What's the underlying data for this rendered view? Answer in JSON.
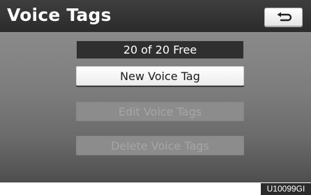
{
  "header": {
    "title": "Voice Tags",
    "back_icon": "return-arrow-icon"
  },
  "status": {
    "free_count_text": "20 of 20 Free"
  },
  "menu": {
    "new_label": "New Voice Tag",
    "edit_label": "Edit Voice Tags",
    "delete_label": "Delete Voice Tags",
    "edit_enabled": false,
    "delete_enabled": false
  },
  "footer": {
    "image_code": "U10099GI"
  },
  "colors": {
    "title_bar": "#2b2b2b",
    "screen_background": "#8a8a8a",
    "button_active": "#ffffff",
    "button_disabled_text": "#a6a6a6"
  }
}
